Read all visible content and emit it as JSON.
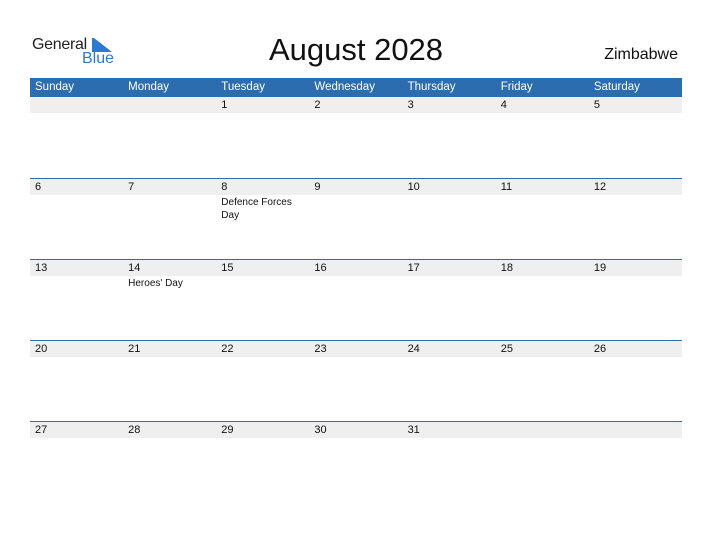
{
  "logo": {
    "word1": "General",
    "word2": "Blue",
    "brand_color": "#2a7bd1"
  },
  "header": {
    "title": "August 2028",
    "country": "Zimbabwe"
  },
  "colors": {
    "header_bg": "#2c6db0",
    "day_strip_bg": "#efefef"
  },
  "weekdays": [
    "Sunday",
    "Monday",
    "Tuesday",
    "Wednesday",
    "Thursday",
    "Friday",
    "Saturday"
  ],
  "weeks": [
    [
      {
        "day": ""
      },
      {
        "day": ""
      },
      {
        "day": "1"
      },
      {
        "day": "2"
      },
      {
        "day": "3"
      },
      {
        "day": "4"
      },
      {
        "day": "5"
      }
    ],
    [
      {
        "day": "6"
      },
      {
        "day": "7"
      },
      {
        "day": "8",
        "holiday": "Defence Forces Day"
      },
      {
        "day": "9"
      },
      {
        "day": "10"
      },
      {
        "day": "11"
      },
      {
        "day": "12"
      }
    ],
    [
      {
        "day": "13"
      },
      {
        "day": "14",
        "holiday": "Heroes' Day"
      },
      {
        "day": "15"
      },
      {
        "day": "16"
      },
      {
        "day": "17"
      },
      {
        "day": "18"
      },
      {
        "day": "19"
      }
    ],
    [
      {
        "day": "20"
      },
      {
        "day": "21"
      },
      {
        "day": "22"
      },
      {
        "day": "23"
      },
      {
        "day": "24"
      },
      {
        "day": "25"
      },
      {
        "day": "26"
      }
    ],
    [
      {
        "day": "27"
      },
      {
        "day": "28"
      },
      {
        "day": "29"
      },
      {
        "day": "30"
      },
      {
        "day": "31"
      },
      {
        "day": ""
      },
      {
        "day": ""
      }
    ]
  ]
}
